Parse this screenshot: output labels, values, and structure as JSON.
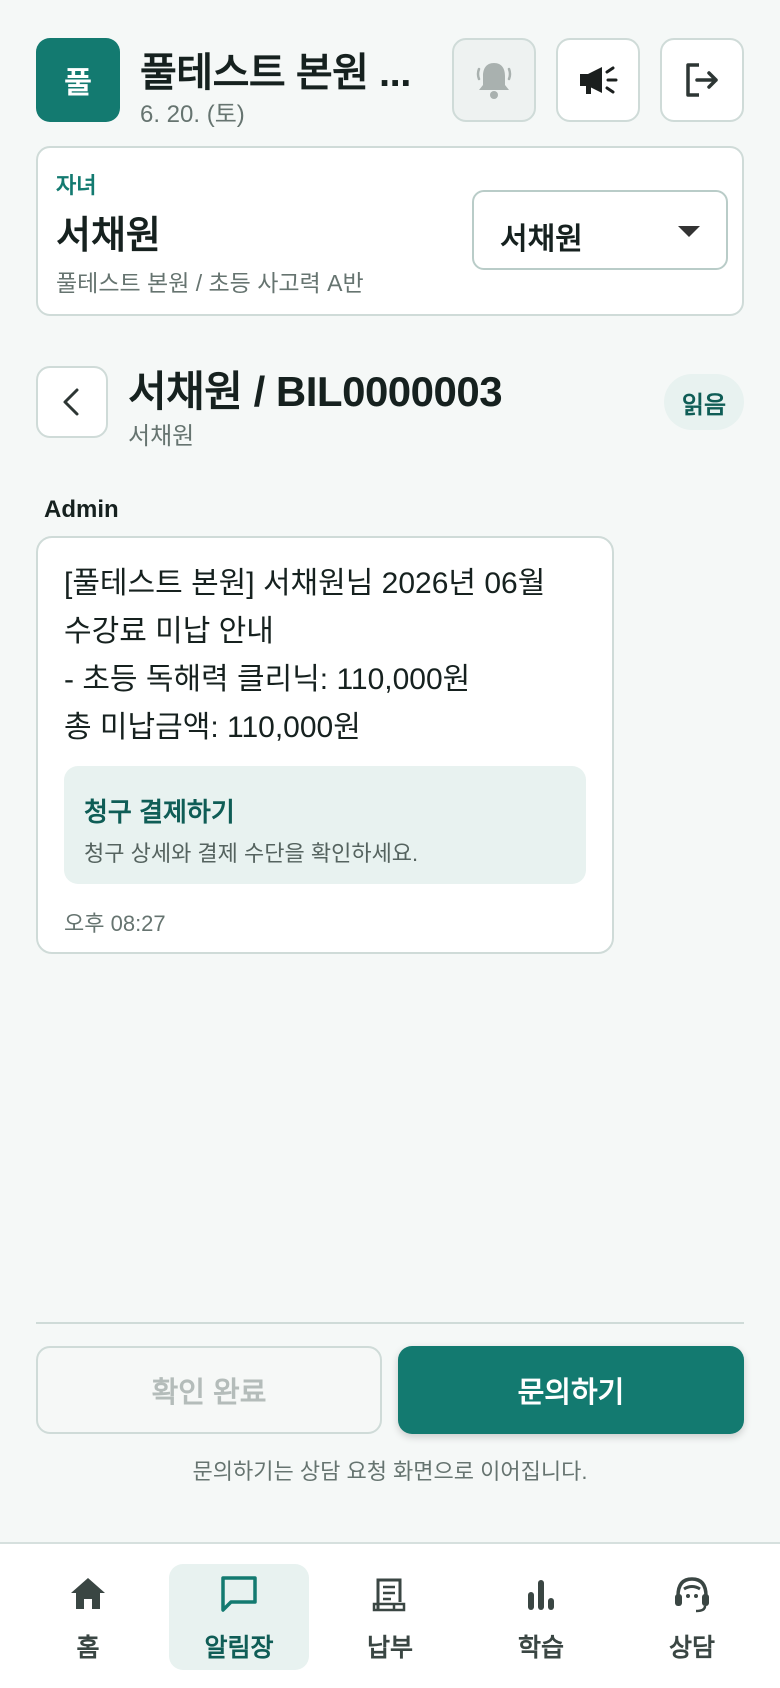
{
  "header": {
    "logo_text": "풀",
    "title": "풀테스트 본원 ...",
    "date": "6. 20. (토)",
    "icons": [
      "bell-icon",
      "megaphone-icon",
      "logout-icon"
    ]
  },
  "child": {
    "label": "자녀",
    "name": "서채원",
    "class_info": "풀테스트 본원 / 초등 사고력 A반",
    "selected": "서채원"
  },
  "thread": {
    "title": "서채원 / BIL0000003",
    "subtitle": "서채원",
    "badge": "읽음"
  },
  "message": {
    "sender": "Admin",
    "body": "[풀테스트 본원] 서채원님 2026년 06월\n수강료 미납 안내\n- 초등 독해력 클리닉: 110,000원\n총 미납금액: 110,000원",
    "pay_title": "청구 결제하기",
    "pay_desc": "청구 상세와 결제 수단을 확인하세요.",
    "time": "오후 08:27"
  },
  "actions": {
    "confirm": "확인 완료",
    "inquire": "문의하기",
    "note": "문의하기는 상담 요청 화면으로 이어집니다."
  },
  "nav": {
    "items": [
      {
        "label": "홈",
        "icon": "home-icon"
      },
      {
        "label": "알림장",
        "icon": "chat-icon",
        "active": true
      },
      {
        "label": "납부",
        "icon": "receipt-icon"
      },
      {
        "label": "학습",
        "icon": "chart-icon"
      },
      {
        "label": "상담",
        "icon": "headset-icon"
      }
    ]
  },
  "colors": {
    "primary": "#137a70",
    "primary_dark": "#0f5d56",
    "soft": "#e8f2f0",
    "background": "#f5f8f7"
  }
}
